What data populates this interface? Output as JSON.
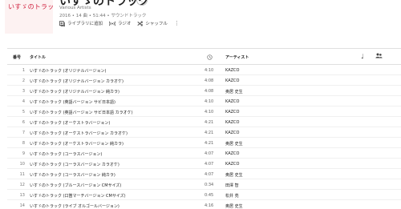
{
  "album": {
    "art_text": "いすゞのトラック",
    "title": "いすゞのトラック",
    "more_symbol": "⋮",
    "artist": "Various Artists",
    "meta": "2016 • 14 曲 • 51:44 • サウンドトラック"
  },
  "actions": {
    "library": "ライブラリに追加",
    "radio": "ラジオ",
    "shuffle": "シャッフル",
    "more": "⋮"
  },
  "table": {
    "headers": {
      "num": "番号",
      "title": "タイトル",
      "artist": "アーティスト"
    },
    "clock_icon": "clock-icon",
    "note_icon": "♩",
    "rows": [
      {
        "num": "1",
        "title": "いすゞのトラック (オリジナルバージョン)",
        "duration": "4:10",
        "artist": "KAZCO"
      },
      {
        "num": "2",
        "title": "いすゞのトラック (オリジナルバージョン カラオケ)",
        "duration": "4:08",
        "artist": "KAZCO"
      },
      {
        "num": "3",
        "title": "いすゞのトラック (オリジナルバージョン 純カラ)",
        "duration": "4:08",
        "artist": "奥居 史生"
      },
      {
        "num": "4",
        "title": "いすゞのトラック (英語バージョン サビ日本語)",
        "duration": "4:10",
        "artist": "KAZCO"
      },
      {
        "num": "5",
        "title": "いすゞのトラック (英語バージョン サビ日本語 カラオケ)",
        "duration": "4:10",
        "artist": "KAZCO"
      },
      {
        "num": "6",
        "title": "いすゞのトラック (オーケストラバージョン)",
        "duration": "4:21",
        "artist": "KAZCO"
      },
      {
        "num": "7",
        "title": "いすゞのトラック (オーケストラバージョン カラオケ)",
        "duration": "4:21",
        "artist": "KAZCO"
      },
      {
        "num": "8",
        "title": "いすゞのトラック (オーケストラバージョン 純カラ)",
        "duration": "4:21",
        "artist": "奥居 史生"
      },
      {
        "num": "9",
        "title": "いすゞのトラック (コーラスバージョン)",
        "duration": "4:07",
        "artist": "KAZCO"
      },
      {
        "num": "10",
        "title": "いすゞのトラック (コーラスバージョン カラオケ)",
        "duration": "4:07",
        "artist": "KAZCO"
      },
      {
        "num": "11",
        "title": "いすゞのトラック (コーラスバージョン 純カラ)",
        "duration": "4:07",
        "artist": "奥居 史生"
      },
      {
        "num": "12",
        "title": "いすゞのトラック (ブルースバージョン CMサイズ)",
        "duration": "0:34",
        "artist": "田澤 智"
      },
      {
        "num": "13",
        "title": "いすゞのトラック (口笛マーチバージョン CMサイズ)",
        "duration": "0:45",
        "artist": "松井 亮"
      },
      {
        "num": "14",
        "title": "いすゞのトラック (ライブ オルゴールバージョン)",
        "duration": "4:16",
        "artist": "奥居 史生"
      }
    ]
  }
}
